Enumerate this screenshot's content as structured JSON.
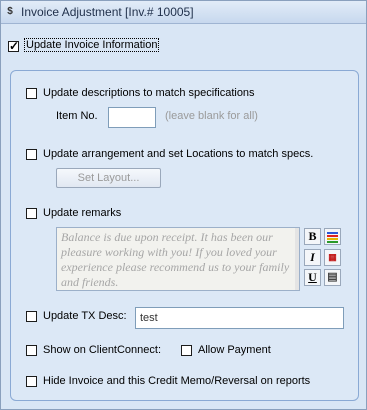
{
  "window": {
    "title": "Invoice Adjustment [Inv.# 10005]",
    "icon": "app-icon"
  },
  "update_invoice": {
    "label": "Update Invoice Information",
    "checked": true
  },
  "options": {
    "descriptions": {
      "label": "Update descriptions to match specifications",
      "checked": false,
      "item_no_label": "Item No.",
      "item_no_value": "",
      "item_no_hint": "(leave blank for all)"
    },
    "arrangement": {
      "label": "Update arrangement and set Locations to match specs.",
      "checked": false,
      "set_layout_label": "Set Layout..."
    },
    "remarks": {
      "label": "Update remarks",
      "checked": false,
      "text": "Balance is due upon receipt.  It has been our pleasure working with you!  If you loved your experience please recommend us to your family and friends.",
      "toolbar": [
        "bold-icon",
        "color-lines-icon",
        "italic-icon",
        "calendar-icon",
        "underline-icon",
        "printer-icon"
      ]
    },
    "tx_desc": {
      "label": "Update TX Desc:",
      "checked": false,
      "value": "test"
    },
    "client_connect": {
      "label": "Show on ClientConnect:",
      "checked": false,
      "allow_payment_label": "Allow Payment",
      "allow_payment_checked": false
    },
    "hide_invoice": {
      "label": "Hide Invoice and this Credit Memo/Reversal on reports",
      "checked": false
    }
  },
  "colors": {
    "background": "#d9e6f5",
    "group_border": "#8aa9d4",
    "disabled_text": "#9a9a9a"
  }
}
